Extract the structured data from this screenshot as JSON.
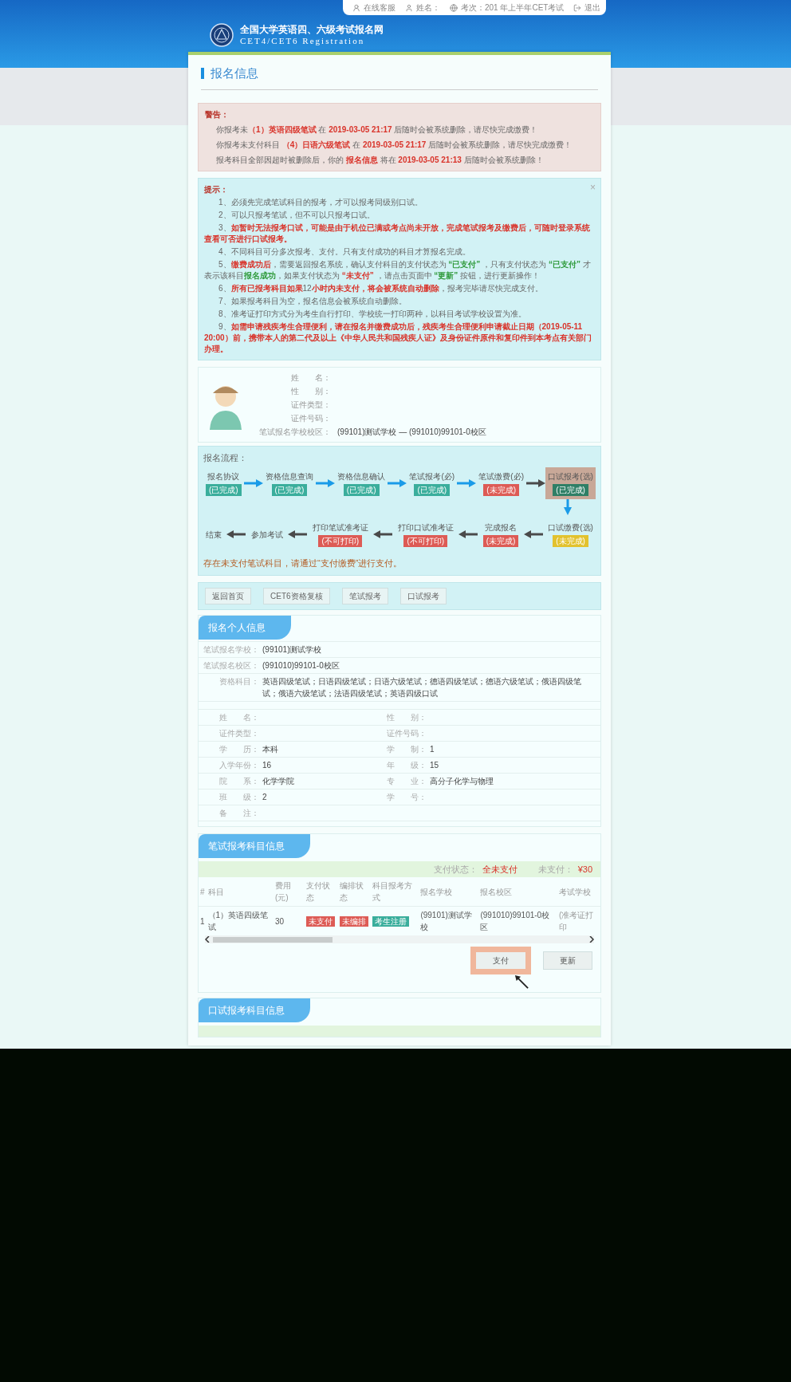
{
  "top_nav": [
    {
      "kind": "service",
      "label": "在线客服"
    },
    {
      "kind": "user",
      "label": "姓名："
    },
    {
      "kind": "session",
      "label": "考次：201 年上半年CET考试"
    },
    {
      "kind": "logout",
      "label": "退出"
    }
  ],
  "site": {
    "title": "全国大学英语四、六级考试报名网",
    "subtitle": "CET4/CET6 Registration"
  },
  "page_title": "报名信息",
  "warning": {
    "heading": "警告：",
    "lines": [
      [
        {
          "text": "你报考未",
          "kind": "plain"
        },
        {
          "text": "（1）英语四级笔试",
          "kind": "red"
        },
        {
          "text": " 在 ",
          "kind": "plain"
        },
        {
          "text": "2019-03-05 21:17",
          "kind": "red"
        },
        {
          "text": " 后随时会被系统删除，请尽快完成缴费！",
          "kind": "plain"
        }
      ],
      [
        {
          "text": "你报考未支付科目 ",
          "kind": "plain"
        },
        {
          "text": "（4）日语六级笔试",
          "kind": "red"
        },
        {
          "text": " 在 ",
          "kind": "plain"
        },
        {
          "text": "2019-03-05 21:17",
          "kind": "red"
        },
        {
          "text": " 后随时会被系统删除，请尽快完成缴费！",
          "kind": "plain"
        }
      ],
      [
        {
          "text": "报考科目全部因超时被删除后，你的 ",
          "kind": "plain"
        },
        {
          "text": "报名信息",
          "kind": "red"
        },
        {
          "text": " 将在 ",
          "kind": "plain"
        },
        {
          "text": "2019-03-05 21:13",
          "kind": "red"
        },
        {
          "text": " 后随时会被系统删除！",
          "kind": "plain"
        }
      ]
    ]
  },
  "tips": {
    "heading": "提示：",
    "close": "×",
    "lines": [
      [
        {
          "text": "1、必须先完成笔试科目的报考，才可以报考同级别口试。",
          "kind": "plain"
        }
      ],
      [
        {
          "text": "2、可以只报考笔试，但不可以只报考口试。",
          "kind": "plain"
        }
      ],
      [
        {
          "text": "3、",
          "kind": "plain"
        },
        {
          "text": "如暂时无法报考口试，可能是由于机位已满或考点尚未开放，完成笔试报考及缴费后，可随时登录系统查看可否进行口试报考。",
          "kind": "red"
        }
      ],
      [
        {
          "text": "4、不同科目可分多次报考、支付。只有支付成功的科目才算报名完成。",
          "kind": "plain"
        }
      ],
      [
        {
          "text": "5、",
          "kind": "plain"
        },
        {
          "text": "缴费成功后",
          "kind": "red"
        },
        {
          "text": "，需要返回报名系统，确认支付科目的支付状态为 ",
          "kind": "plain"
        },
        {
          "text": "“已支付”",
          "kind": "green"
        },
        {
          "text": " ，只有支付状态为 ",
          "kind": "plain"
        },
        {
          "text": "“已支付”",
          "kind": "green"
        },
        {
          "text": " 才表示该科目",
          "kind": "plain"
        },
        {
          "text": "报名成功",
          "kind": "green"
        },
        {
          "text": "，如果支付状态为 ",
          "kind": "plain"
        },
        {
          "text": "“未支付”",
          "kind": "red"
        },
        {
          "text": " ，请点击页面中 ",
          "kind": "plain"
        },
        {
          "text": "“更新”",
          "kind": "green"
        },
        {
          "text": " 按钮，进行更新操作！",
          "kind": "plain"
        }
      ],
      [
        {
          "text": "6、",
          "kind": "plain"
        },
        {
          "text": "所有已报考科目如果",
          "kind": "red"
        },
        {
          "text": "12",
          "kind": "plain"
        },
        {
          "text": "小时内未支付，将会被系统自动删除",
          "kind": "red"
        },
        {
          "text": "，报考完毕请尽快完成支付。",
          "kind": "plain"
        }
      ],
      [
        {
          "text": "7、如果报考科目为空，报名信息会被系统自动删除。",
          "kind": "plain"
        }
      ],
      [
        {
          "text": "8、准考证打印方式分为考生自行打印、学校统一打印两种，以科目考试学校设置为准。",
          "kind": "plain"
        }
      ],
      [
        {
          "text": "9、",
          "kind": "plain"
        },
        {
          "text": "如需申请残疾考生合理便利，请在报名并缴费成功后，残疾考生合理便利申请截止日期（2019-05-11 20:00）前，携带本人的第二代及以上《中华人民共和国残疾人证》及身份证件原件和复印件到本考点有关部门办理。",
          "kind": "red"
        }
      ]
    ]
  },
  "profile": [
    {
      "label": "姓　　名："
    },
    {
      "label": "性　　别："
    },
    {
      "label": "证件类型："
    },
    {
      "label": "证件号码："
    },
    {
      "label": "笔试报名学校校区：",
      "value": "(99101)测试学校 — (991010)99101-0校区"
    }
  ],
  "flow": {
    "title": "报名流程：",
    "rows": [
      {
        "reversed": false,
        "steps": [
          {
            "label": "报名协议",
            "status": "(已完成)",
            "kind": "done",
            "highlighted": false,
            "arrow_active": true
          },
          {
            "label": "资格信息查询",
            "status": "(已完成)",
            "kind": "done",
            "highlighted": false,
            "arrow_active": true
          },
          {
            "label": "资格信息确认",
            "status": "(已完成)",
            "kind": "done",
            "highlighted": false,
            "arrow_active": true
          },
          {
            "label": "笔试报考(必)",
            "status": "(已完成)",
            "kind": "done",
            "highlighted": false,
            "arrow_active": true
          },
          {
            "label": "笔试缴费(必)",
            "status": "(未完成)",
            "kind": "todo",
            "highlighted": false,
            "arrow_active": false
          },
          {
            "label": "口试报考(选)",
            "status": "(已完成)",
            "kind": "done",
            "highlighted": true,
            "arrow_active": true
          }
        ]
      },
      {
        "reversed": true,
        "steps": [
          {
            "label": "结束",
            "highlighted": false,
            "arrow_active": false
          },
          {
            "label": "参加考试",
            "highlighted": false,
            "arrow_active": false
          },
          {
            "label": "打印笔试准考证",
            "status": "(不可打印)",
            "kind": "todo",
            "highlighted": false,
            "arrow_active": false
          },
          {
            "label": "打印口试准考证",
            "status": "(不可打印)",
            "kind": "todo",
            "highlighted": false,
            "arrow_active": false
          },
          {
            "label": "完成报名",
            "status": "(未完成)",
            "kind": "todo",
            "highlighted": false,
            "arrow_active": false
          },
          {
            "label": "口试缴费(选)",
            "status": "(未完成)",
            "kind": "pending",
            "highlighted": false
          }
        ]
      }
    ],
    "note": "存在未支付笔试科目，请通过“支付缴费”进行支付。"
  },
  "actions": [
    "返回首页",
    "CET6资格复核",
    "笔试报考",
    "口试报考"
  ],
  "personal": {
    "title": "报名个人信息",
    "wide_rows": [
      {
        "label": "笔试报名学校：",
        "value": "(99101)测试学校"
      },
      {
        "label": "笔试报名校区：",
        "value": "(991010)99101-0校区"
      },
      {
        "label": "资格科目：",
        "value": "英语四级笔试；日语四级笔试；日语六级笔试；德语四级笔试；德语六级笔试；俄语四级笔试；俄语六级笔试；法语四级笔试；英语四级口试"
      }
    ],
    "pairs": [
      [
        {
          "label": "姓　　名："
        },
        {
          "label": "性　　别："
        }
      ],
      [
        {
          "label": "证件类型："
        },
        {
          "label": "证件号码："
        }
      ],
      [
        {
          "label": "学　　历：",
          "value": "本科"
        },
        {
          "label": "学　　制：",
          "value": "1"
        }
      ],
      [
        {
          "label": "入学年份：",
          "value": "16"
        },
        {
          "label": "年　　级：",
          "value": "15"
        }
      ],
      [
        {
          "label": "院　　系：",
          "value": "化学学院"
        },
        {
          "label": "专　　业：",
          "value": "高分子化学与物理"
        }
      ],
      [
        {
          "label": "班　　级：",
          "value": "2"
        },
        {
          "label": "学　　号："
        }
      ]
    ],
    "remark": {
      "label": "备　　注："
    }
  },
  "written": {
    "title": "笔试报考科目信息",
    "pay_status_label": "支付状态：",
    "pay_status": "全未支付",
    "unpaid_label": "未支付：",
    "unpaid_amount": "¥30",
    "columns": [
      "#",
      "科目",
      "费用(元)",
      "支付状态",
      "编排状态",
      "科目报考方式",
      "报名学校",
      "报名校区",
      "考试学校"
    ],
    "rows": [
      [
        {
          "kind": "text",
          "text": "1"
        },
        {
          "kind": "text",
          "text": "（1）英语四级笔试"
        },
        {
          "kind": "text",
          "text": "30"
        },
        {
          "kind": "badge_danger",
          "text": "未支付"
        },
        {
          "kind": "badge_danger",
          "text": "未编排"
        },
        {
          "kind": "badge_info",
          "text": "考生注册"
        },
        {
          "kind": "text",
          "text": "(99101)测试学校"
        },
        {
          "kind": "text",
          "text": "(991010)99101-0校区"
        },
        {
          "kind": "muted",
          "text": "(准考证打印"
        }
      ]
    ],
    "buttons": [
      {
        "label": "支付",
        "highlighted": true
      },
      {
        "label": "更新",
        "highlighted": false
      }
    ]
  },
  "oral": {
    "title": "口试报考科目信息"
  }
}
